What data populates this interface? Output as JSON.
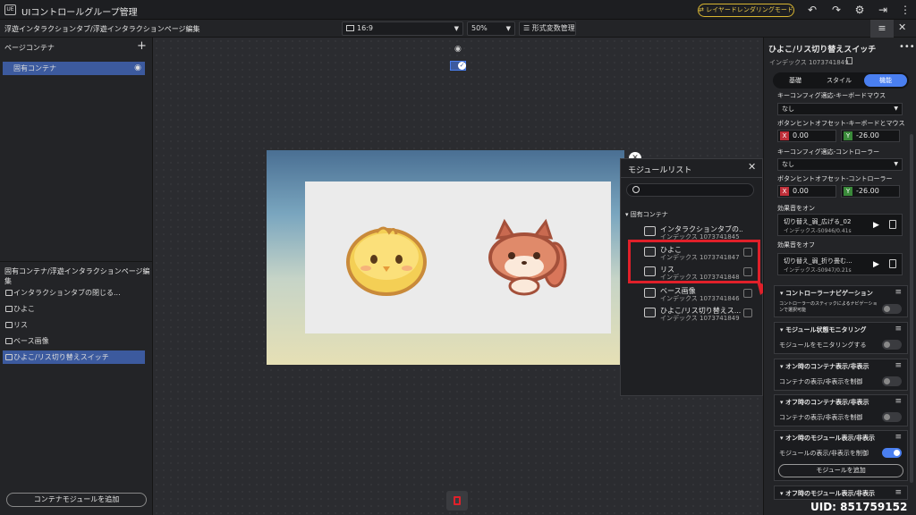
{
  "titlebar": {
    "app_icon_text": "UE",
    "title": "UIコントロールグループ管理",
    "layered_rendering_mode": "⇄ レイヤードレンダリングモード"
  },
  "toolbar": {
    "breadcrumb": "浮遊インタラクションタブ/浮遊インタラクションページ編集",
    "aspect_ratio": "16:9",
    "zoom": "50%",
    "format_vars": "形式変数管理"
  },
  "left_panel": {
    "page_container_title": "ページコンテナ",
    "add_symbol": "+",
    "page_items": [
      {
        "label": "固有コンテナ"
      }
    ],
    "edit_section_title": "固有コンテナ/浮遊インタラクションページ編集",
    "tree_items": [
      {
        "label": "インタラクションタブの閉じる..."
      },
      {
        "label": "ひよこ"
      },
      {
        "label": "リス"
      },
      {
        "label": "ベース画像"
      },
      {
        "label": "ひよこ/リス切り替えスイッチ"
      }
    ],
    "add_module_button": "コンテナモジュールを追加"
  },
  "module_list": {
    "title": "モジュールリスト",
    "group": "固有コンテナ",
    "items": [
      {
        "name": "インタラクションタブの...",
        "index": "インデックス 1073741845",
        "icon": "button-icon"
      },
      {
        "name": "ひよこ",
        "index": "インデックス 1073741847",
        "icon": "image-icon"
      },
      {
        "name": "リス",
        "index": "インデックス 1073741848",
        "icon": "image-icon"
      },
      {
        "name": "ベース画像",
        "index": "インデックス 1073741846",
        "icon": "image-icon"
      },
      {
        "name": "ひよこ/リス切り替えス...",
        "index": "インデックス 1073741849",
        "icon": "switch-icon"
      }
    ]
  },
  "right_panel": {
    "title": "ひよこ/リス切り替えスイッチ",
    "index": "インデックス 1073741849",
    "tabs": [
      "基礎",
      "スタイル",
      "機能"
    ],
    "active_tab": "機能",
    "key_config_keyboard_label": "キーコンフィグ適応-キーボードマウス",
    "key_config_keyboard_value": "なし",
    "hint_offset_keyboard_label": "ボタンヒントオフセット-キーボードとマウス",
    "hint_offset_keyboard": {
      "x_tag": "X",
      "x": "0.00",
      "y_tag": "Y",
      "y": "-26.00"
    },
    "key_config_controller_label": "キーコンフィグ適応-コントローラー",
    "key_config_controller_value": "なし",
    "hint_offset_controller_label": "ボタンヒントオフセット-コントローラー",
    "hint_offset_controller": {
      "x_tag": "X",
      "x": "0.00",
      "y_tag": "Y",
      "y": "-26.00"
    },
    "sound_on_label": "効果音をオン",
    "sound_on": {
      "name": "切り替え_弱_広げる_02",
      "info": "インデックス-50946/0.41s"
    },
    "sound_off_label": "効果音をオフ",
    "sound_off": {
      "name": "切り替え_弱_折り畳む...",
      "info": "インデックス-50947/0.21s"
    },
    "sections": [
      {
        "header": "コントローラーナビゲーション",
        "sub": "コントローラーのスティックによるナビゲーションで選択可能",
        "toggle": false
      },
      {
        "header": "モジュール状態モニタリング",
        "sub": "モジュールをモニタリングする",
        "toggle": false
      },
      {
        "header": "オン時のコンテナ表示/非表示",
        "sub": "コンテナの表示/非表示を制御",
        "toggle": false
      },
      {
        "header": "オフ時のコンテナ表示/非表示",
        "sub": "コンテナの表示/非表示を制御",
        "toggle": false
      },
      {
        "header": "オン時のモジュール表示/非表示",
        "sub": "モジュールの表示/非表示を制御",
        "toggle": true,
        "button": "モジュールを追加"
      },
      {
        "header": "オフ時のモジュール表示/非表示"
      }
    ],
    "uid": "UID: 851759152"
  },
  "colors": {
    "accent": "#3c5a9e",
    "tab_active": "#4a7ff0",
    "highlight_red": "#e0202a",
    "button_yellow": "#d8b531"
  }
}
